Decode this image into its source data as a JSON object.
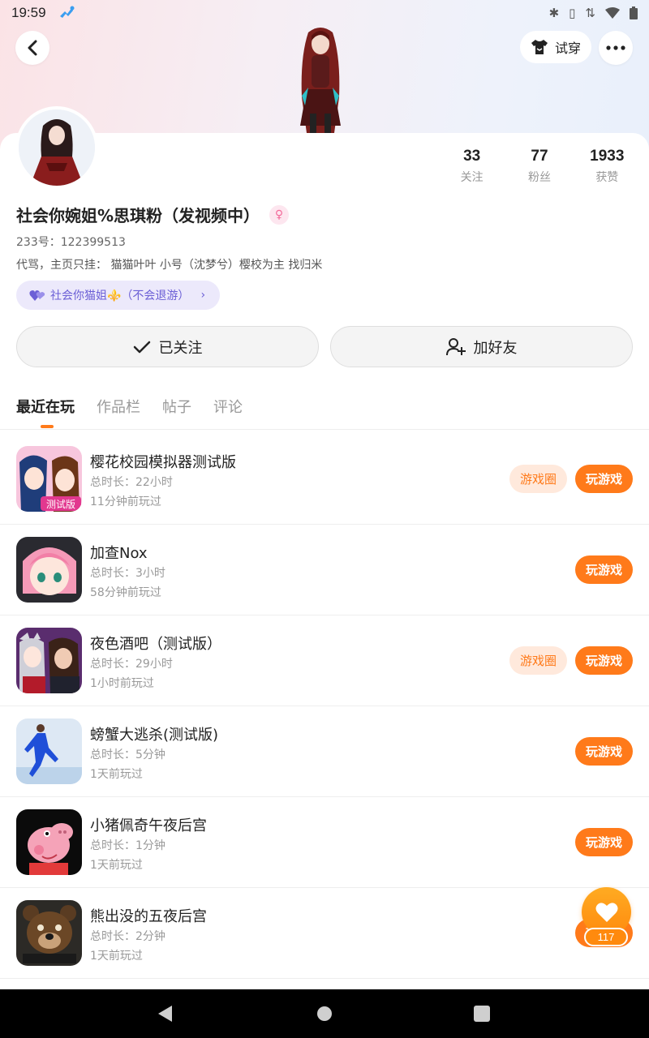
{
  "status_bar": {
    "time": "19:59"
  },
  "header": {
    "try_label": "试穿"
  },
  "profile": {
    "name": "社会你婉姐%思琪粉（发视频中）",
    "uid": "233号：122399513",
    "bio": "代骂，主页只挂：  猫猫叶叶 小号（沈梦兮）樱校为主 找归米",
    "guild": "社会你猫姐⚜️（不会退游）",
    "stats": [
      {
        "num": "33",
        "label": "关注"
      },
      {
        "num": "77",
        "label": "粉丝"
      },
      {
        "num": "1933",
        "label": "获赞"
      }
    ]
  },
  "actions": {
    "follow_label": "已关注",
    "friend_label": "加好友"
  },
  "tabs": [
    "最近在玩",
    "作品栏",
    "帖子",
    "评论"
  ],
  "games": [
    {
      "title": "樱花校园模拟器测试版",
      "duration": "总时长：22小时",
      "last_played": "11分钟前玩过",
      "circle_label": "游戏圈",
      "play_label": "玩游戏",
      "icon": "sakura-school-icon"
    },
    {
      "title": "加查Nox",
      "duration": "总时长：3小时",
      "last_played": "58分钟前玩过",
      "play_label": "玩游戏",
      "icon": "gacha-nox-icon"
    },
    {
      "title": "夜色酒吧（测试版）",
      "duration": "总时长：29小时",
      "last_played": "1小时前玩过",
      "circle_label": "游戏圈",
      "play_label": "玩游戏",
      "icon": "night-bar-icon"
    },
    {
      "title": "螃蟹大逃杀(测试版)",
      "duration": "总时长：5分钟",
      "last_played": "1天前玩过",
      "play_label": "玩游戏",
      "icon": "crab-escape-icon"
    },
    {
      "title": "小猪佩奇午夜后宫",
      "duration": "总时长：1分钟",
      "last_played": "1天前玩过",
      "play_label": "玩游戏",
      "icon": "peppa-pig-icon"
    },
    {
      "title": "熊出没的五夜后宫",
      "duration": "总时长：2分钟",
      "last_played": "1天前玩过",
      "play_label": "玩游戏",
      "icon": "bear-fnaf-icon"
    }
  ],
  "like": {
    "count": "117"
  },
  "colors": {
    "accent": "#ff7a1a",
    "guild_bg": "#ece9fb",
    "guild_text": "#6b5fd6"
  }
}
